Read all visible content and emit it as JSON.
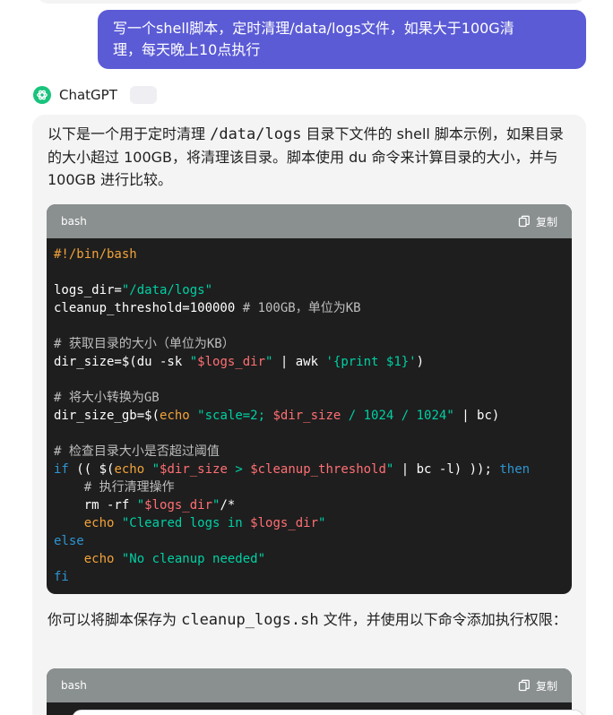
{
  "user_message": {
    "line1": "写一个shell脚本，定时清理/data/logs文件，如果大于100G清",
    "line2": "理，每天晚上10点执行"
  },
  "assistant": {
    "name": "ChatGPT",
    "intro": {
      "part1": "以下是一个用于定时清理 ",
      "path": "/data/logs",
      "part2": " 目录下文件的 shell 脚本示例，如果目录的大小超过 100GB，将清理该目录。脚本使用 du 命令来计算目录的大小，并与 100GB 进行比较。"
    },
    "after_text": {
      "part1": "你可以将脚本保存为 ",
      "filename": "cleanup_logs.sh",
      "part2": " 文件，并使用以下命令添加执行权限："
    }
  },
  "code_blocks": [
    {
      "lang": "bash",
      "copy_label": "复制",
      "lines": [
        [
          {
            "t": "#!/bin/bash",
            "c": "shebang"
          }
        ],
        [],
        [
          {
            "t": "logs_dir=",
            "c": ""
          },
          {
            "t": "\"/data/logs\"",
            "c": "string"
          }
        ],
        [
          {
            "t": "cleanup_threshold=100000 ",
            "c": ""
          },
          {
            "t": "# 100GB，单位为KB",
            "c": "comment"
          }
        ],
        [],
        [
          {
            "t": "# 获取目录的大小（单位为KB）",
            "c": "comment"
          }
        ],
        [
          {
            "t": "dir_size=$(du -sk ",
            "c": ""
          },
          {
            "t": "\"",
            "c": "string"
          },
          {
            "t": "$logs_dir",
            "c": "var"
          },
          {
            "t": "\"",
            "c": "string"
          },
          {
            "t": " | awk ",
            "c": ""
          },
          {
            "t": "'{print $1}'",
            "c": "string"
          },
          {
            "t": ")",
            "c": ""
          }
        ],
        [],
        [
          {
            "t": "# 将大小转换为GB",
            "c": "comment"
          }
        ],
        [
          {
            "t": "dir_size_gb=$(",
            "c": ""
          },
          {
            "t": "echo",
            "c": "builtin"
          },
          {
            "t": " ",
            "c": ""
          },
          {
            "t": "\"scale=2; ",
            "c": "string"
          },
          {
            "t": "$dir_size",
            "c": "var"
          },
          {
            "t": " / 1024 / 1024\"",
            "c": "string"
          },
          {
            "t": " | bc)",
            "c": ""
          }
        ],
        [],
        [
          {
            "t": "# 检查目录大小是否超过阈值",
            "c": "comment"
          }
        ],
        [
          {
            "t": "if",
            "c": "keyword"
          },
          {
            "t": " (( $(",
            "c": ""
          },
          {
            "t": "echo",
            "c": "builtin"
          },
          {
            "t": " ",
            "c": ""
          },
          {
            "t": "\"",
            "c": "string"
          },
          {
            "t": "$dir_size",
            "c": "var"
          },
          {
            "t": " > ",
            "c": "string"
          },
          {
            "t": "$cleanup_threshold",
            "c": "var"
          },
          {
            "t": "\"",
            "c": "string"
          },
          {
            "t": " | bc -l) )); ",
            "c": ""
          },
          {
            "t": "then",
            "c": "keyword"
          }
        ],
        [
          {
            "t": "    # 执行清理操作",
            "c": "comment"
          }
        ],
        [
          {
            "t": "    rm -rf ",
            "c": ""
          },
          {
            "t": "\"",
            "c": "string"
          },
          {
            "t": "$logs_dir",
            "c": "var"
          },
          {
            "t": "\"",
            "c": "string"
          },
          {
            "t": "/*",
            "c": ""
          }
        ],
        [
          {
            "t": "    ",
            "c": ""
          },
          {
            "t": "echo",
            "c": "builtin"
          },
          {
            "t": " ",
            "c": ""
          },
          {
            "t": "\"Cleared logs in ",
            "c": "string"
          },
          {
            "t": "$logs_dir",
            "c": "var"
          },
          {
            "t": "\"",
            "c": "string"
          }
        ],
        [
          {
            "t": "else",
            "c": "keyword"
          }
        ],
        [
          {
            "t": "    ",
            "c": ""
          },
          {
            "t": "echo",
            "c": "builtin"
          },
          {
            "t": " ",
            "c": ""
          },
          {
            "t": "\"No cleanup needed\"",
            "c": "string"
          }
        ],
        [
          {
            "t": "fi",
            "c": "keyword"
          }
        ]
      ]
    },
    {
      "lang": "bash",
      "copy_label": "复制",
      "lines": []
    }
  ],
  "colors": {
    "user_bubble": "#5b5bd6",
    "code_bg": "#1e1e1e",
    "code_header": "#8a8f8f",
    "string": "#00d0a4",
    "variable": "#ff6f73",
    "builtin": "#f2a33a",
    "keyword": "#2e95d3",
    "comment": "#bdbdbd"
  },
  "icons": {
    "assistant_avatar": "openai-logo-icon",
    "copy": "copy-icon"
  }
}
